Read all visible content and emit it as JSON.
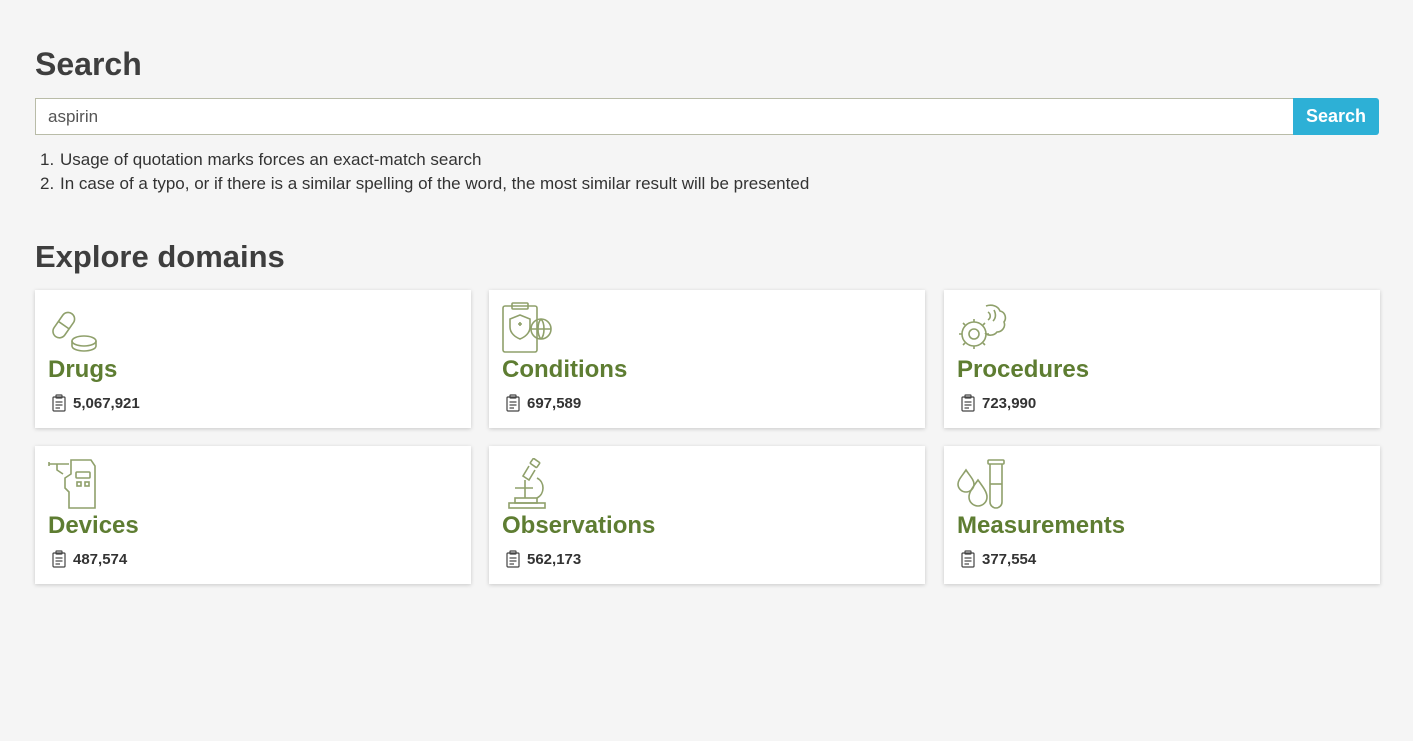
{
  "search": {
    "title": "Search",
    "value": "aspirin",
    "button_label": "Search",
    "tips": [
      {
        "num": "1.",
        "text": "Usage of quotation marks forces an exact-match search"
      },
      {
        "num": "2.",
        "text": "In case of a typo, or if there is a similar spelling of the word, the most similar result will be presented"
      }
    ]
  },
  "explore": {
    "title": "Explore domains",
    "domains": [
      {
        "name": "Drugs",
        "count": "5,067,921",
        "icon": "pill-icon"
      },
      {
        "name": "Conditions",
        "count": "697,589",
        "icon": "clipboard-shield-icon"
      },
      {
        "name": "Procedures",
        "count": "723,990",
        "icon": "brain-gear-icon"
      },
      {
        "name": "Devices",
        "count": "487,574",
        "icon": "device-icon"
      },
      {
        "name": "Observations",
        "count": "562,173",
        "icon": "microscope-icon"
      },
      {
        "name": "Measurements",
        "count": "377,554",
        "icon": "test-tube-icon"
      }
    ]
  },
  "colors": {
    "accent": "#2db0d6",
    "domain_green": "#5e7d32",
    "icon_green": "#8fa06b"
  }
}
